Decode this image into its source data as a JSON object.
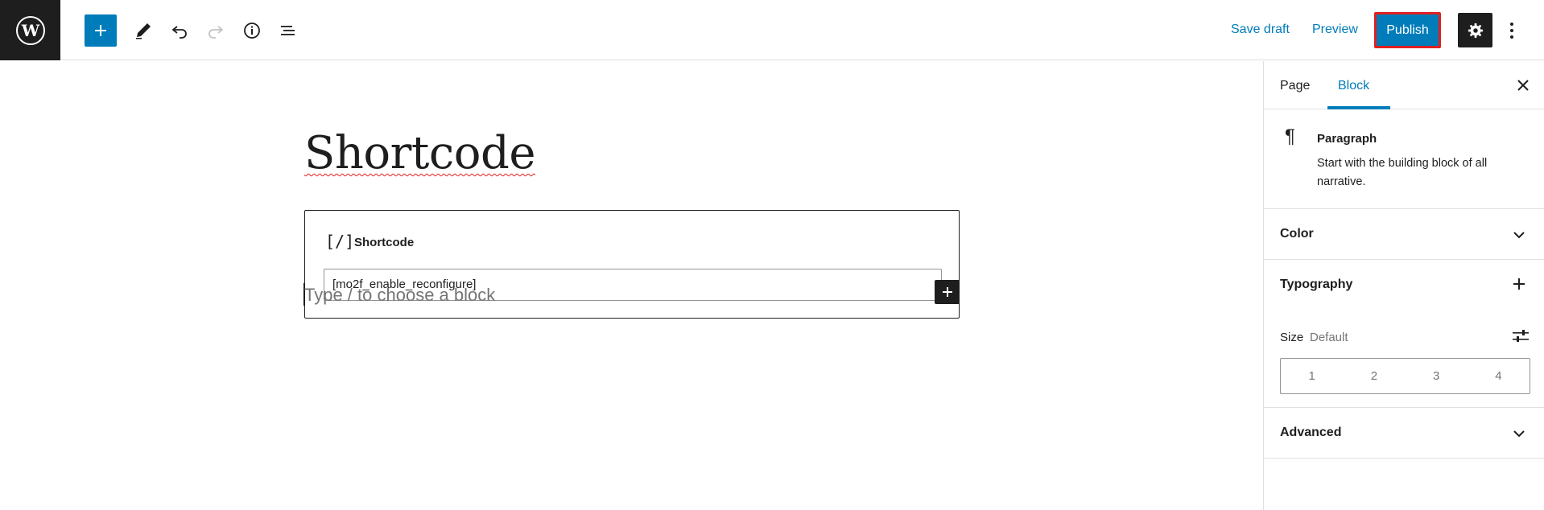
{
  "toolbar": {
    "add_block_icon": "plus-icon",
    "tools_icon": "pencil-icon",
    "undo_icon": "undo-icon",
    "redo_icon": "redo-icon",
    "details_icon": "info-icon",
    "list_view_icon": "list-view-icon",
    "save_draft_label": "Save draft",
    "preview_label": "Preview",
    "publish_label": "Publish",
    "settings_icon": "gear-icon",
    "more_icon": "more-vertical-icon"
  },
  "editor": {
    "title": "Shortcode",
    "shortcode_block": {
      "icon_glyph": "[/]",
      "label": "Shortcode",
      "value": "[mo2f_enable_reconfigure]"
    },
    "placeholder": "Type / to choose a block"
  },
  "sidebar": {
    "tabs": [
      {
        "label": "Page",
        "active": false
      },
      {
        "label": "Block",
        "active": true
      }
    ],
    "block_card": {
      "name": "Paragraph",
      "description": "Start with the building block of all narrative."
    },
    "panels": {
      "color": "Color",
      "typography": "Typography",
      "advanced": "Advanced"
    },
    "typography": {
      "size_label": "Size",
      "size_value": "Default",
      "size_options": [
        "1",
        "2",
        "3",
        "4"
      ]
    }
  },
  "colors": {
    "accent": "#007cba",
    "dark": "#1e1e1e",
    "publish_outline": "#e02020"
  }
}
